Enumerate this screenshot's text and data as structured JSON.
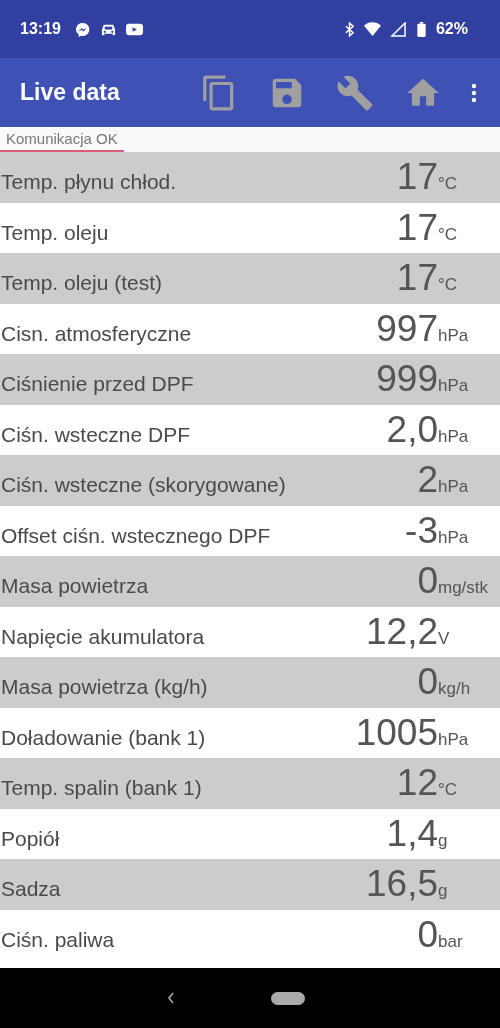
{
  "status_bar": {
    "time": "13:19",
    "battery": "62%"
  },
  "toolbar": {
    "title": "Live data"
  },
  "connection": {
    "text": "Komunikacja OK"
  },
  "rows": [
    {
      "label": "Temp. płynu chłod.",
      "value": "17",
      "unit": "°C"
    },
    {
      "label": "Temp. oleju",
      "value": "17",
      "unit": "°C"
    },
    {
      "label": "Temp. oleju (test)",
      "value": "17",
      "unit": "°C"
    },
    {
      "label": "Cisn. atmosferyczne",
      "value": "997",
      "unit": "hPa"
    },
    {
      "label": "Ciśnienie przed DPF",
      "value": "999",
      "unit": "hPa"
    },
    {
      "label": "Ciśn. wsteczne DPF",
      "value": "2,0",
      "unit": "hPa"
    },
    {
      "label": "Ciśn. wsteczne (skorygowane)",
      "value": "2",
      "unit": "hPa"
    },
    {
      "label": "Offset ciśn. wstecznego DPF",
      "value": "-3",
      "unit": "hPa"
    },
    {
      "label": "Masa powietrza",
      "value": "0",
      "unit": "mg/stk"
    },
    {
      "label": "Napięcie akumulatora",
      "value": "12,2",
      "unit": "V"
    },
    {
      "label": "Masa powietrza (kg/h)",
      "value": "0",
      "unit": "kg/h"
    },
    {
      "label": "Doładowanie (bank 1)",
      "value": "1005",
      "unit": "hPa"
    },
    {
      "label": "Temp. spalin (bank 1)",
      "value": "12",
      "unit": "°C"
    },
    {
      "label": "Popiół",
      "value": "1,4",
      "unit": "g"
    },
    {
      "label": "Sadza",
      "value": "16,5",
      "unit": "g"
    },
    {
      "label": "Ciśn. paliwa",
      "value": "0",
      "unit": "bar"
    }
  ]
}
